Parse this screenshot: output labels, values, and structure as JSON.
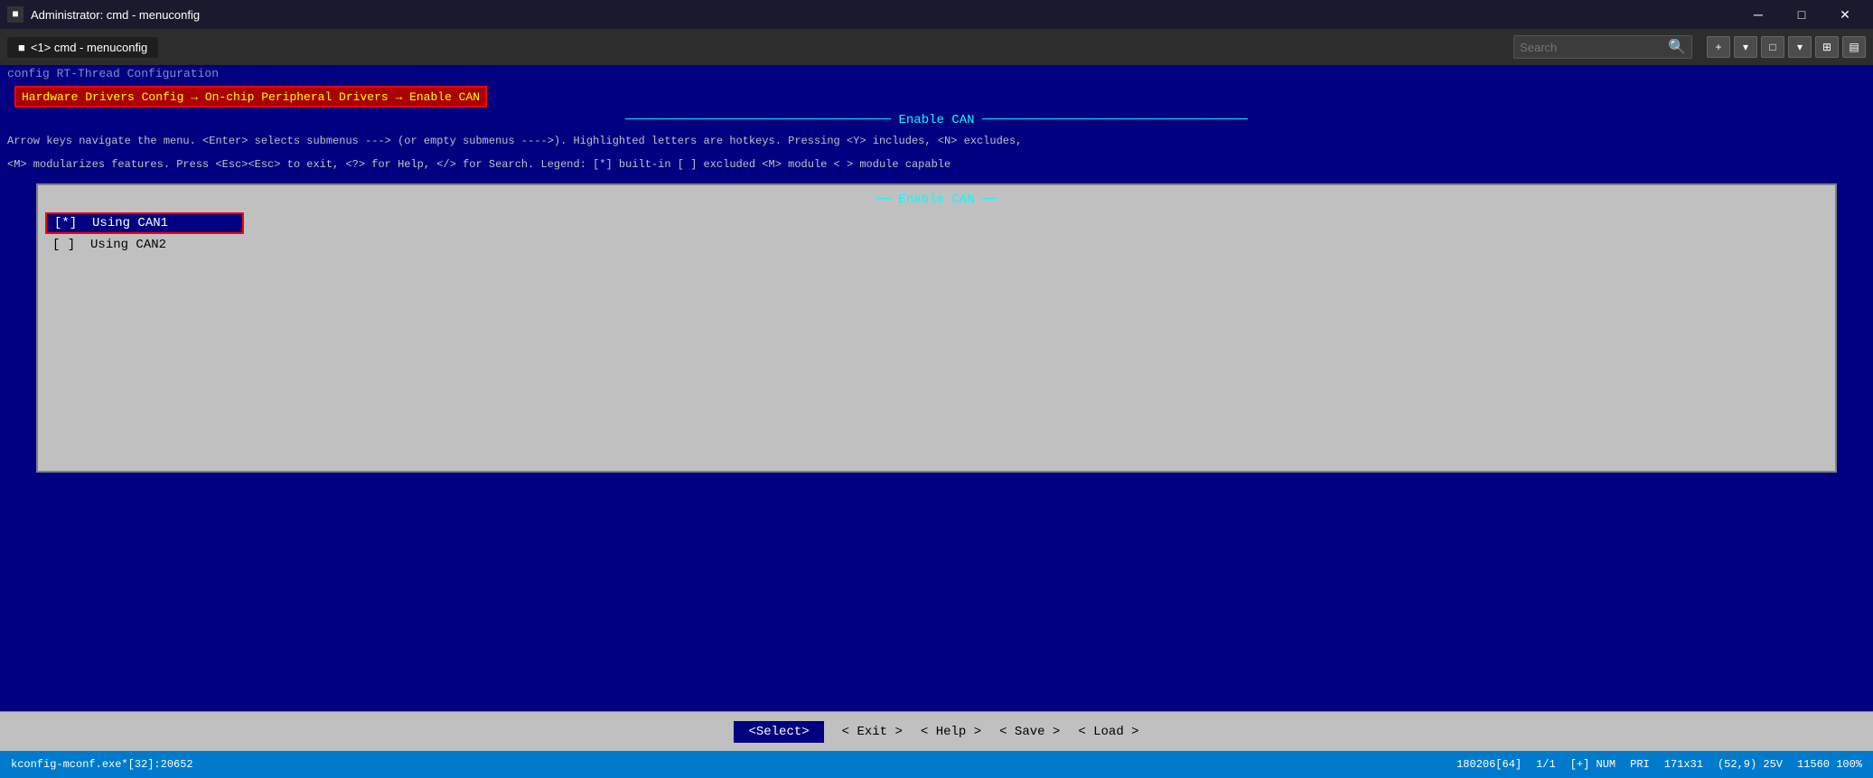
{
  "titleBar": {
    "icon": "■",
    "title": "Administrator: cmd - menuconfig",
    "minimizeLabel": "─",
    "maximizeLabel": "□",
    "closeLabel": "✕"
  },
  "cmdChrome": {
    "tabIcon": "■",
    "tabLabel": "<1> cmd - menuconfig",
    "searchPlaceholder": "Search",
    "toolbarBtns": [
      "+",
      "▾",
      "□",
      "▾",
      "⊞",
      "▤"
    ]
  },
  "menuconfig": {
    "fadedHeader": "config    RT-Thread Configuration",
    "breadcrumb": "Hardware Drivers Config → On-chip Peripheral Drivers → Enable CAN",
    "enableCanTitle": "Enable CAN",
    "infoLine1": "Arrow keys navigate the menu.  <Enter> selects submenus --->  (or empty submenus ---->).  Highlighted letters are hotkeys.  Pressing <Y> includes, <N> excludes,",
    "infoLine2": "<M> modularizes features.  Press <Esc><Esc> to exit, <?> for Help, </> for Search.  Legend: [*] built-in  [ ] excluded  <M> module  < > module capable",
    "dialogTitle": "── Enable CAN ──",
    "menuItems": [
      {
        "id": "can1",
        "checked": true,
        "label": "Using CAN1",
        "selected": true
      },
      {
        "id": "can2",
        "checked": false,
        "label": "Using CAN2",
        "selected": false
      }
    ]
  },
  "bottomBar": {
    "selectBtn": "<Select>",
    "exitBtn": "< Exit >",
    "helpBtn": "< Help >",
    "saveBtn": "< Save >",
    "loadBtn": "< Load >"
  },
  "statusBar": {
    "left": "kconfig-mconf.exe*[32]:20652",
    "pos": "180206[64]",
    "page": "1/1",
    "mode": "[+] NUM",
    "pri": "PRI",
    "size": "171x31",
    "coords": "(52,9) 25V",
    "zoom": "11560 100%"
  }
}
